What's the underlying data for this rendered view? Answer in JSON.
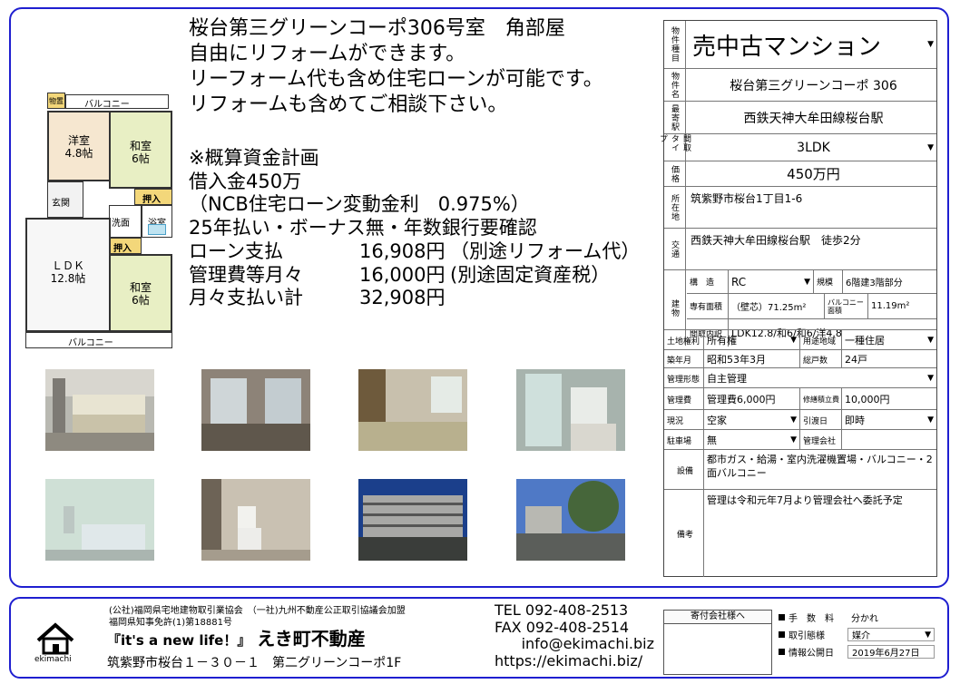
{
  "headline": [
    "桜台第三グリーンコーポ306号室　角部屋",
    "自由にリフォームができます。",
    "リーフォーム代も含め住宅ローンが可能です。",
    "リフォームも含めてご相談下さい。"
  ],
  "plan": {
    "title": "※概算資金計画",
    "loan_amount": "借入金450万",
    "rate": "（NCB住宅ローン変動金利　0.975%）",
    "terms": "25年払い・ボーナス無・年数銀行要確認",
    "rows": [
      {
        "label": "ローン支払",
        "value": "16,908円",
        "note": "（別途リフォーム代）"
      },
      {
        "label": "管理費等月々",
        "value": "16,000円",
        "note": "(別途固定資産税）"
      },
      {
        "label": "月々支払い計",
        "value": "32,908円",
        "note": ""
      }
    ]
  },
  "floorplan": {
    "balcony_top": "バルコニー",
    "balcony_bottom": "バルコニー",
    "storage": "物置",
    "western": "洋室\n4.8帖",
    "japanese1": "和室\n6帖",
    "japanese2": "和室\n6帖",
    "ldk": "ＬＤＫ\n12.8帖",
    "entrance": "玄関",
    "wash": "洗面",
    "bath": "浴室",
    "closet1": "押入",
    "closet2": "押入"
  },
  "spec": {
    "type": {
      "label": "物件種目",
      "value": "売中古マンション"
    },
    "name": {
      "label": "物件名",
      "value": "桜台第三グリーンコーポ 306"
    },
    "station": {
      "label": "最寄駅",
      "value": "西鉄天神大牟田線桜台駅"
    },
    "layout": {
      "label": "間取タイプ",
      "value": "3LDK"
    },
    "price": {
      "label": "価格",
      "value": "450万円"
    },
    "address": {
      "label": "所在地",
      "value": "筑紫野市桜台1丁目1-6"
    },
    "access": {
      "label": "交通",
      "value": "西鉄天神大牟田線桜台駅　徒歩2分"
    },
    "building_label": "建物",
    "structure": {
      "label": "構　造",
      "value": "RC"
    },
    "scale": {
      "label": "規模",
      "value": "6階建3階部分"
    },
    "area": {
      "label": "専有面積",
      "value": "（壁芯）71.25m²"
    },
    "balcony_area": {
      "label": "バルコニー面積",
      "value": "11.19m²"
    },
    "rooms": {
      "label": "間取内訳",
      "value": "LDK12.8/和6/和6/洋4.8"
    },
    "land_right": {
      "label": "土地権利",
      "value": "所有権"
    },
    "zoning": {
      "label": "用途地域",
      "value": "一種住居"
    },
    "built": {
      "label": "築年月",
      "value": "昭和53年3月"
    },
    "units": {
      "label": "総戸数",
      "value": "24戸"
    },
    "management": {
      "label": "管理形態",
      "value": "自主管理"
    },
    "mgmt_fee": {
      "label": "管理費",
      "value": "管理費6,000円"
    },
    "repair_fund": {
      "label": "修繕積立費",
      "value": "10,000円"
    },
    "status": {
      "label": "現況",
      "value": "空家"
    },
    "handover": {
      "label": "引渡日",
      "value": "即時"
    },
    "parking": {
      "label": "駐車場",
      "value": "無"
    },
    "mgmt_company": {
      "label": "管理会社",
      "value": ""
    },
    "facilities": {
      "label": "設備",
      "value": "都市ガス・給湯・室内洗濯機置場・バルコニー・2面バルコニー"
    },
    "remarks": {
      "label": "備考",
      "value": "管理は令和元年7月より管理会社へ委託予定"
    }
  },
  "footer": {
    "assoc1": "(公社)福岡県宅地建物取引業協会　（一社)九州不動産公正取引協議会加盟",
    "license": "福岡県知事免許(1)第18881号",
    "logo_text": "ekimachi",
    "slogan": "『it's a new life！』",
    "company": "えき町不動産",
    "address": "筑紫野市桜台１－３０－１　第二グリーンコーポ1F",
    "tel": "TEL 092-408-2513",
    "fax": "FAX 092-408-2514",
    "email": "info@ekimachi.biz",
    "url": "https://ekimachi.biz/",
    "agent_box": "寄付会社様へ",
    "fee": {
      "label": "手　数　料",
      "value": "分かれ"
    },
    "deal": {
      "label": "取引態様",
      "value": "媒介"
    },
    "published": {
      "label": "情報公開日",
      "value": "2019年6月27日"
    }
  },
  "colors": {
    "frame": "#1f1fd0",
    "tatami": "#e8efc4",
    "closet": "#f3d77a"
  },
  "photos": [
    "kitchen-photo",
    "japanese-room-photo",
    "tatami-room-photo",
    "washroom-photo",
    "bathroom-photo",
    "toilet-photo",
    "building-photo",
    "exterior-photo"
  ]
}
